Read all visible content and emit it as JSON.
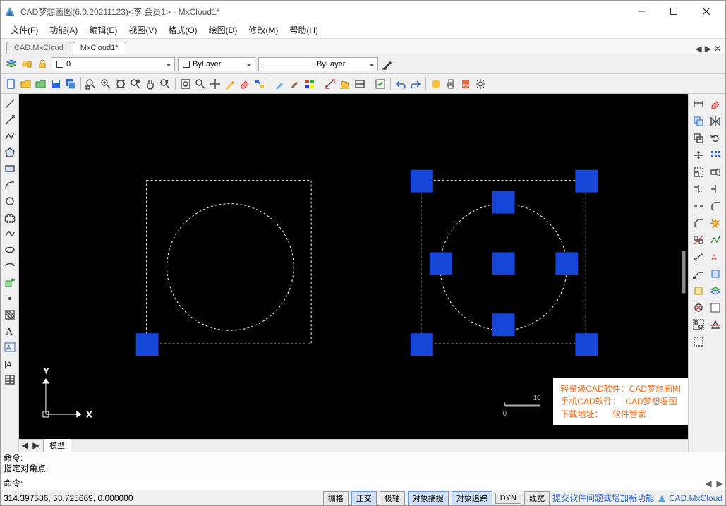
{
  "window": {
    "title": "CAD梦想画图(6.0.20211123)<李,会员1> - MxCloud1*"
  },
  "menu": [
    "文件(F)",
    "功能(A)",
    "编辑(E)",
    "视图(V)",
    "格式(O)",
    "绘图(D)",
    "修改(M)",
    "帮助(H)"
  ],
  "tabs": [
    {
      "label": "CAD.MxCloud",
      "active": false
    },
    {
      "label": "MxCloud1*",
      "active": true
    }
  ],
  "prop": {
    "layer": "0",
    "color": "ByLayer",
    "linetype": "ByLayer"
  },
  "modeltab": "模型",
  "cmd": {
    "hist": [
      "命令:",
      "指定对角点:"
    ],
    "prompt": "命令:"
  },
  "status": {
    "coords": "314.397586,  53.725669,  0.000000",
    "buttons": [
      {
        "label": "栅格",
        "active": false
      },
      {
        "label": "正交",
        "active": true
      },
      {
        "label": "极轴",
        "active": false
      },
      {
        "label": "对象捕捉",
        "active": true
      },
      {
        "label": "对象追踪",
        "active": true
      },
      {
        "label": "DYN",
        "active": false
      },
      {
        "label": "线宽",
        "active": false
      }
    ],
    "link": "提交软件问题或增加新功能",
    "brand": "CAD.MxCloud"
  },
  "info": {
    "l1a": "轻量级CAD软件：",
    "l1b": "CAD梦想画图",
    "l2a": "手机CAD软件：",
    "l2b": "CAD梦想看图",
    "l3a": "下载地址：",
    "l3b": "软件管家"
  },
  "ruler": {
    "tick0": "0",
    "tick10": "10"
  }
}
